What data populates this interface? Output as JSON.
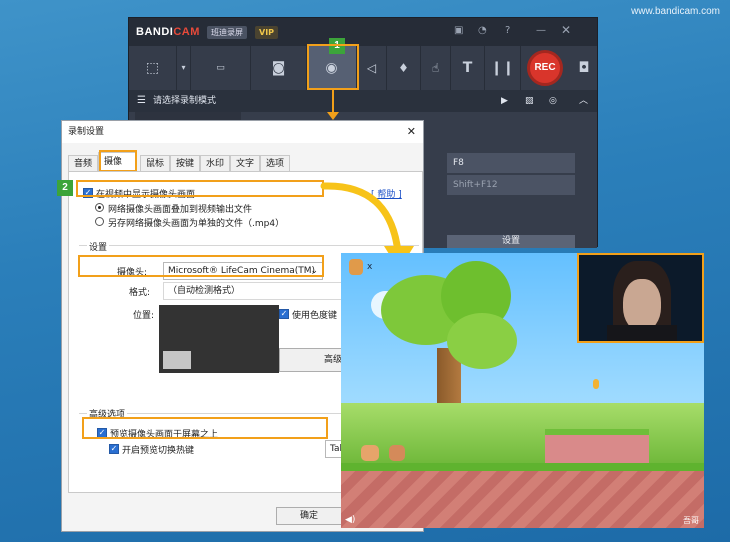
{
  "watermark": "www.bandicam.com",
  "bandicam": {
    "logo_a": "BANDI",
    "logo_b": "CAM",
    "app_name": "班迪录屏",
    "vip": "VIP",
    "mode_bar": "请选择录制模式",
    "rec": "REC",
    "hotkey1": "F8",
    "hotkey2": "Shift+F12",
    "settings_btn": "设置",
    "tools": [
      "rect-mode-icon",
      "hdmi-mode-icon",
      "gamepad-mode-icon",
      "webcam-icon",
      "speaker-icon",
      "mic-icon",
      "cursor-icon",
      "text-icon",
      "pause-icon"
    ]
  },
  "callouts": {
    "one": "1",
    "two": "2"
  },
  "dialog": {
    "title": "录制设置",
    "close": "✕",
    "tabs": [
      "音频",
      "摄像头",
      "鼠标",
      "按键",
      "水印",
      "文字",
      "选项"
    ],
    "active_tab": "摄像头",
    "show_webcam": "在视频中显示摄像头画面",
    "help": "[ 帮助 ]",
    "overlay_option": "网络摄像头画面叠加到视频输出文件",
    "separate_option": "另存网络摄像头画面为单独的文件（.mp4）",
    "settings_section": "设置",
    "webcam_label": "摄像头:",
    "webcam_value": "Microsoft® LifeCam Cinema(TM)",
    "format_label": "格式:",
    "format_value": "（自动检测格式）",
    "position_label": "位置:",
    "chroma": "使用色度键",
    "advanced_btn": "高级",
    "advanced_section": "高级选项",
    "preview_on_top": "预览摄像头画面于屏幕之上",
    "toggle_hotkey": "开启预览切换热键",
    "tab_key": "Tab",
    "ok": "确定"
  },
  "game": {
    "lives": "x",
    "logo": "吾哥"
  }
}
